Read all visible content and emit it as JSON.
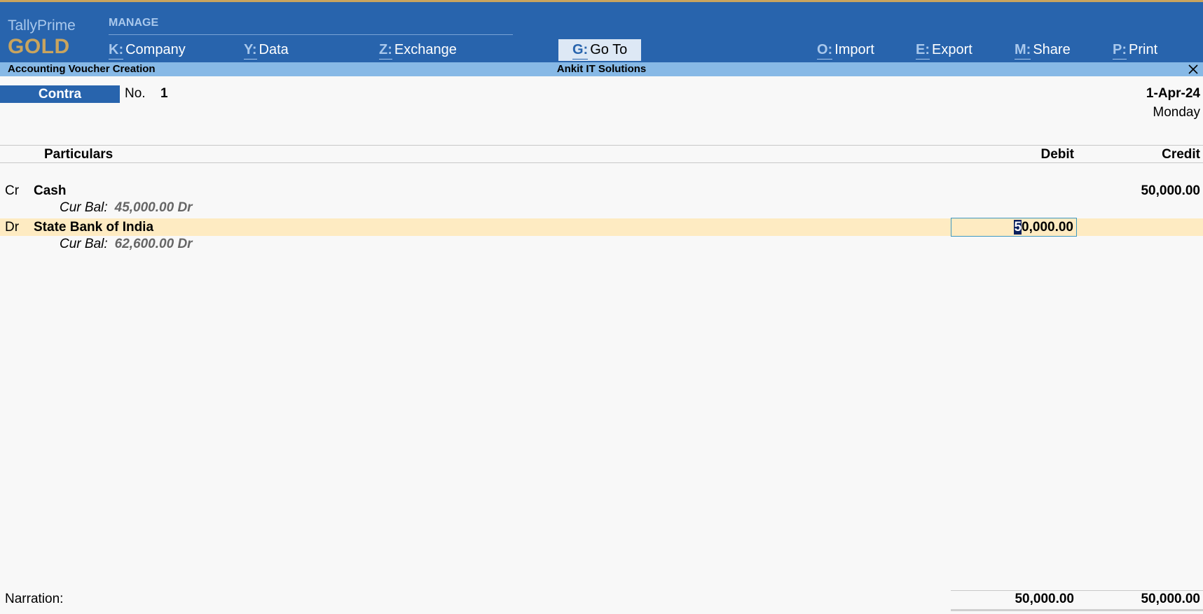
{
  "brand": {
    "name": "TallyPrime",
    "edition": "GOLD"
  },
  "menu": {
    "section_label": "MANAGE",
    "items": [
      {
        "key": "K:",
        "label": "Company"
      },
      {
        "key": "Y:",
        "label": "Data"
      },
      {
        "key": "Z:",
        "label": "Exchange"
      },
      {
        "key": "G:",
        "label": "Go To"
      },
      {
        "key": "O:",
        "label": "Import"
      },
      {
        "key": "E:",
        "label": "Export"
      },
      {
        "key": "M:",
        "label": "Share"
      },
      {
        "key": "P:",
        "label": "Print"
      }
    ]
  },
  "titlebar": {
    "screen_title": "Accounting Voucher Creation",
    "company": "Ankit IT Solutions"
  },
  "voucher": {
    "type": "Contra",
    "no_label": "No.",
    "no_value": "1",
    "date": "1-Apr-24",
    "day": "Monday"
  },
  "columns": {
    "particulars": "Particulars",
    "debit": "Debit",
    "credit": "Credit"
  },
  "entries": [
    {
      "drcr": "Cr",
      "ledger": "Cash",
      "credit": "50,000.00",
      "bal_label": "Cur Bal:",
      "bal_value": "45,000.00 Dr"
    },
    {
      "drcr": "Dr",
      "ledger": "State Bank of India",
      "debit_caret": "5",
      "debit_rest": "0,000.00",
      "bal_label": "Cur Bal:",
      "bal_value": "62,600.00 Dr"
    }
  ],
  "footer": {
    "narration_label": "Narration:",
    "total_debit": "50,000.00",
    "total_credit": "50,000.00"
  },
  "colors": {
    "menu_bg": "#2864ad",
    "title_bg": "#87b9e6",
    "active_row": "#feebc2",
    "gold": "#c9a45e"
  },
  "icons": {
    "close": "close-icon"
  }
}
